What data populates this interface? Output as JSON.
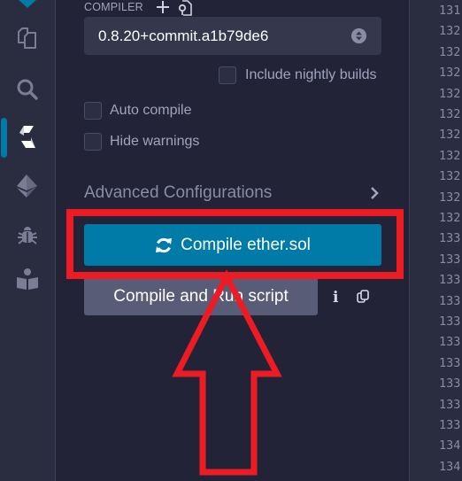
{
  "icon_rail": {
    "items": [
      {
        "name": "home-logo",
        "icon": "remix-logo-icon"
      },
      {
        "name": "file-explorer",
        "icon": "files-icon"
      },
      {
        "name": "search",
        "icon": "search-icon"
      },
      {
        "name": "solidity-compiler",
        "icon": "solidity-icon",
        "active": true
      },
      {
        "name": "deploy-run",
        "icon": "ethereum-icon"
      },
      {
        "name": "debugger",
        "icon": "bug-icon"
      },
      {
        "name": "learneth",
        "icon": "book-reader-icon"
      }
    ],
    "active_color": "#007aa6"
  },
  "compiler": {
    "label": "COMPILER",
    "add_icon": "plus-icon",
    "custom_icon": "file-link-icon",
    "selected_version": "0.8.20+commit.a1b79de6",
    "include_nightly_label": "Include nightly builds",
    "include_nightly_checked": false
  },
  "options": {
    "auto_compile_label": "Auto compile",
    "auto_compile_checked": false,
    "hide_warnings_label": "Hide warnings",
    "hide_warnings_checked": false
  },
  "advanced": {
    "label": "Advanced Configurations"
  },
  "actions": {
    "compile_label": "Compile ether.sol",
    "compile_and_run_label": "Compile and Run script",
    "info_label": "i",
    "primary_color": "#007aa6",
    "secondary_color": "#595c76"
  },
  "editor": {
    "line_numbers": [
      "131",
      "132",
      "132",
      "132",
      "132",
      "132",
      "132",
      "132",
      "132",
      "132",
      "132",
      "133",
      "133",
      "133",
      "133",
      "133",
      "133",
      "133",
      "133",
      "133",
      "133",
      "134",
      "134"
    ]
  },
  "annotation": {
    "color": "#ed1c24",
    "highlight_target": "compile-button",
    "arrow_direction": "up"
  }
}
